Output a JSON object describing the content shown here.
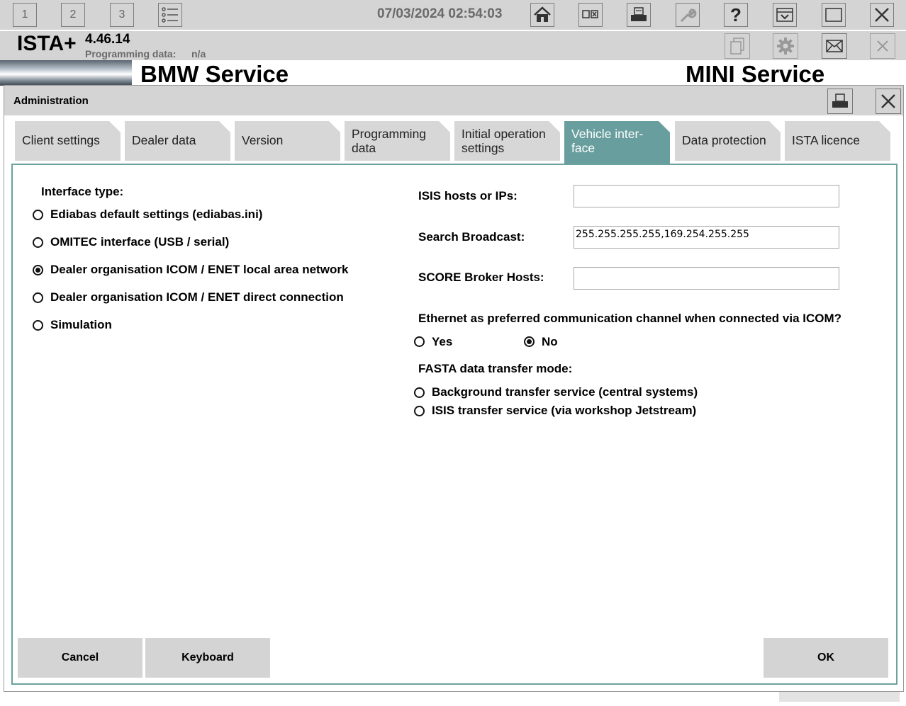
{
  "toolbar": {
    "session_buttons": [
      "1",
      "2",
      "3"
    ],
    "datetime": "07/03/2024 02:54:03"
  },
  "header": {
    "brand": "ISTA+",
    "version": "4.46.14",
    "programming_data_label": "Programming data:",
    "programming_data_value": "n/a"
  },
  "banner": {
    "left": "BMW Service",
    "right": "MINI Service"
  },
  "dialog": {
    "title": "Administration",
    "tabs": [
      {
        "label": "Client settings",
        "active": false
      },
      {
        "label": "Dealer data",
        "active": false
      },
      {
        "label": "Version",
        "active": false
      },
      {
        "label": "Programming data",
        "active": false
      },
      {
        "label": "Initial operation settings",
        "active": false
      },
      {
        "label": "Vehicle inter- face",
        "active": true
      },
      {
        "label": "Data protection",
        "active": false
      },
      {
        "label": "ISTA licence",
        "active": false
      }
    ],
    "interface_type": {
      "label": "Interface type:",
      "options": [
        {
          "label": "Ediabas default settings (ediabas.ini)",
          "selected": false
        },
        {
          "label": "OMITEC interface (USB / serial)",
          "selected": false
        },
        {
          "label": "Dealer organisation ICOM / ENET local area network",
          "selected": true
        },
        {
          "label": "Dealer organisation ICOM / ENET direct connection",
          "selected": false
        },
        {
          "label": "Simulation",
          "selected": false
        }
      ]
    },
    "isis_hosts": {
      "label": "ISIS hosts or IPs:",
      "value": ""
    },
    "search_broadcast": {
      "label": "Search Broadcast:",
      "value": "255.255.255.255,169.254.255.255"
    },
    "score_broker": {
      "label": "SCORE Broker Hosts:",
      "value": ""
    },
    "ethernet": {
      "question": "Ethernet as preferred communication channel when connected via ICOM?",
      "yes_label": "Yes",
      "no_label": "No",
      "selected": "No"
    },
    "fasta": {
      "label": "FASTA data transfer mode:",
      "options": [
        {
          "label": "Background transfer service (central systems)",
          "selected": false
        },
        {
          "label": "ISIS transfer service (via workshop Jetstream)",
          "selected": false
        }
      ]
    },
    "buttons": {
      "cancel": "Cancel",
      "keyboard": "Keyboard",
      "ok": "OK"
    }
  }
}
